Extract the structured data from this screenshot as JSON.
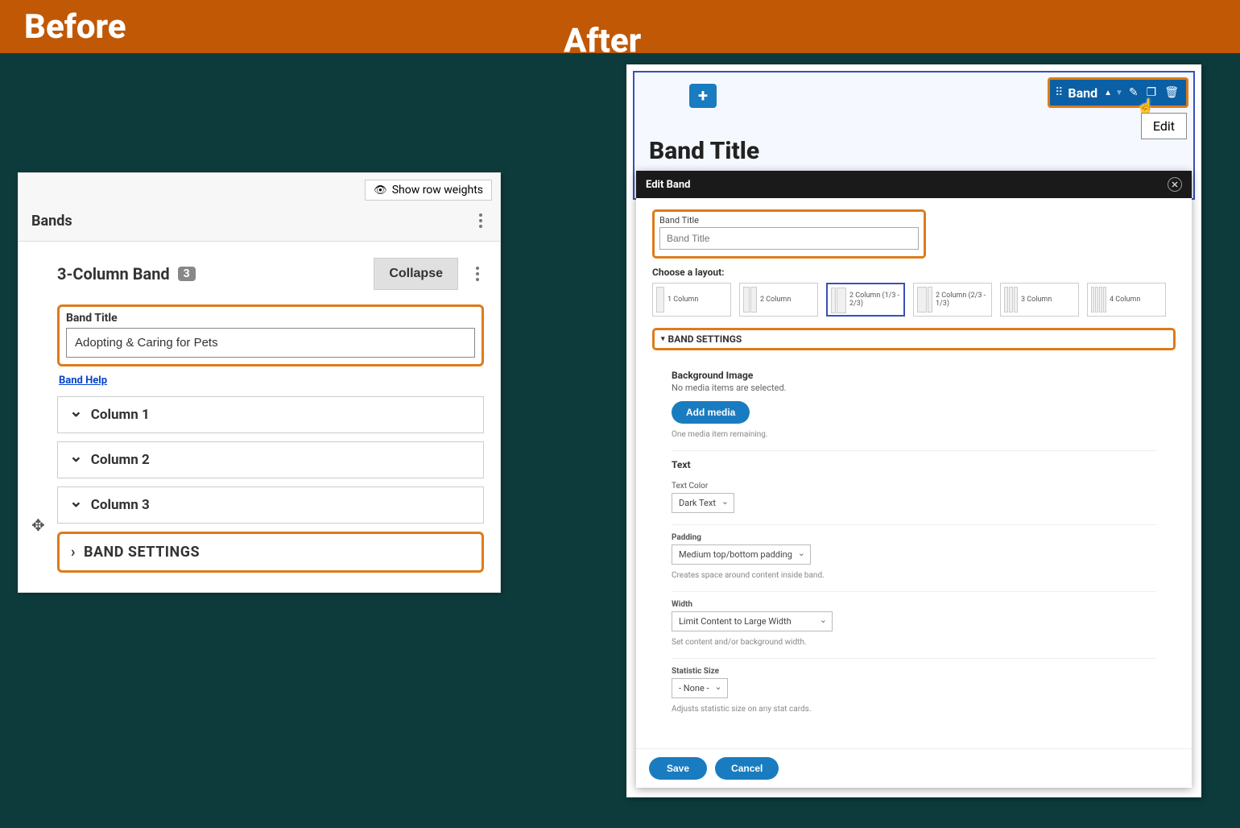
{
  "header": {
    "before_label": "Before",
    "after_label": "After"
  },
  "before": {
    "show_row_weights": "Show row weights",
    "bands_heading": "Bands",
    "band_name": "3-Column Band",
    "band_count": "3",
    "collapse_label": "Collapse",
    "band_title_label": "Band Title",
    "band_title_value": "Adopting & Caring for Pets",
    "band_help": "Band Help",
    "columns": [
      "Column 1",
      "Column 2",
      "Column 3"
    ],
    "band_settings_label": "BAND SETTINGS"
  },
  "after": {
    "toolbar_label": "Band",
    "edit_tooltip": "Edit",
    "band_title_heading": "Band Title",
    "modal": {
      "title": "Edit Band",
      "band_title_label": "Band Title",
      "band_title_placeholder": "Band Title",
      "choose_layout_label": "Choose a layout:",
      "layouts": [
        {
          "label": "1 Column",
          "cols": [
            10
          ]
        },
        {
          "label": "2 Column",
          "cols": [
            8,
            8
          ]
        },
        {
          "label": "2 Column (1/3 - 2/3)",
          "cols": [
            6,
            12
          ]
        },
        {
          "label": "2 Column (2/3 - 1/3)",
          "cols": [
            12,
            6
          ]
        },
        {
          "label": "3 Column",
          "cols": [
            5,
            5,
            5
          ]
        },
        {
          "label": "4 Column",
          "cols": [
            4,
            4,
            4,
            4
          ]
        }
      ],
      "selected_layout_index": 2,
      "band_settings_label": "BAND SETTINGS",
      "bg_image_label": "Background Image",
      "bg_image_sub": "No media items are selected.",
      "add_media_label": "Add media",
      "media_remaining": "One media item remaining.",
      "text_heading": "Text",
      "text_color_label": "Text Color",
      "text_color_value": "Dark Text",
      "padding_label": "Padding",
      "padding_value": "Medium top/bottom padding",
      "padding_hint": "Creates space around content inside band.",
      "width_label": "Width",
      "width_value": "Limit Content to Large Width",
      "width_hint": "Set content and/or background width.",
      "stat_label": "Statistic Size",
      "stat_value": "- None -",
      "stat_hint": "Adjusts statistic size on any stat cards.",
      "save_label": "Save",
      "cancel_label": "Cancel"
    }
  }
}
